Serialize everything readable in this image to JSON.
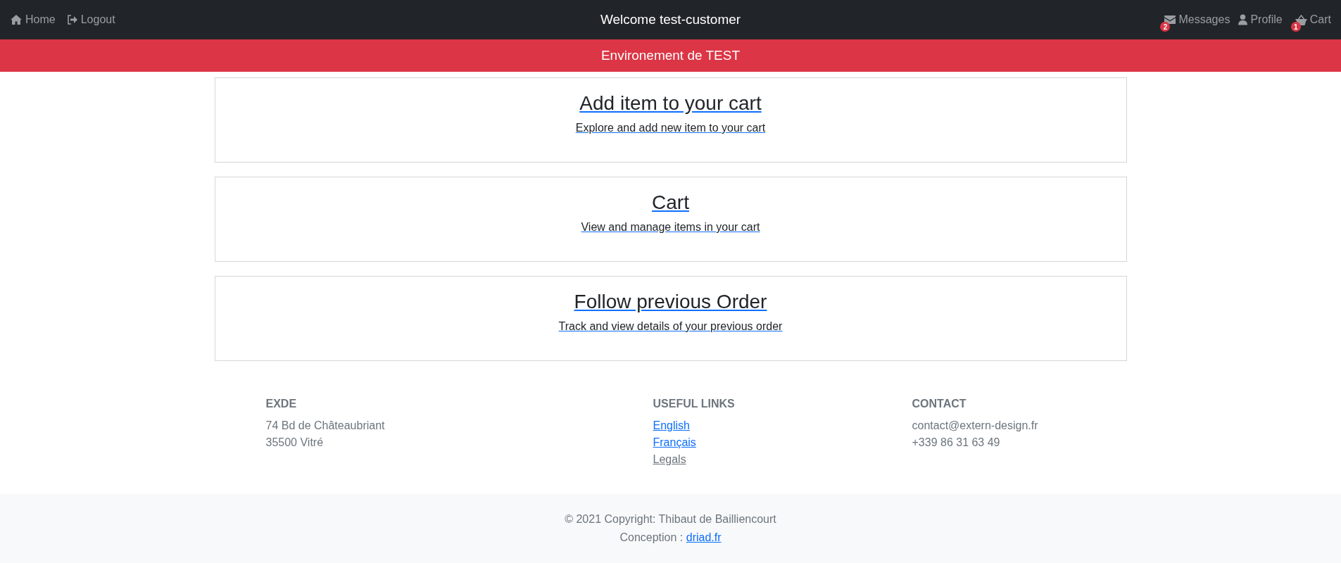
{
  "navbar": {
    "left": [
      {
        "label": "Home",
        "kind": "home"
      },
      {
        "label": "Logout",
        "kind": "logout"
      }
    ],
    "title": "Welcome test-customer",
    "right": [
      {
        "label": "Messages",
        "kind": "mail",
        "badge": "2"
      },
      {
        "label": "Profile",
        "kind": "user"
      },
      {
        "label": "Cart",
        "kind": "basket",
        "badge": "1"
      }
    ]
  },
  "banner": "Environement de TEST",
  "cards": [
    {
      "title": "Add item to your cart",
      "subtitle": "Explore and add new item to your cart"
    },
    {
      "title": "Cart",
      "subtitle": "View and manage items in your cart"
    },
    {
      "title": "Follow previous Order",
      "subtitle": "Track and view details of your previous order"
    }
  ],
  "footer": {
    "columns": [
      {
        "heading": "EXDE",
        "lines": [
          {
            "kind": "text",
            "text": "74 Bd de Châteaubriant"
          },
          {
            "kind": "text",
            "text": "35500 Vitré"
          }
        ]
      },
      {
        "heading": "USEFUL LINKS",
        "lines": [
          {
            "kind": "link",
            "text": "English"
          },
          {
            "kind": "link",
            "text": "Français"
          },
          {
            "kind": "muted-link",
            "text": "Legals"
          }
        ]
      },
      {
        "heading": "CONTACT",
        "lines": [
          {
            "kind": "text",
            "text": "contact@extern-design.fr"
          },
          {
            "kind": "text",
            "text": "+339 86 31 63 49"
          }
        ]
      }
    ],
    "copyright": "© 2021 Copyright: Thibaut de Bailliencourt",
    "conception_label": "Conception :",
    "conception_link": "driad.fr"
  }
}
